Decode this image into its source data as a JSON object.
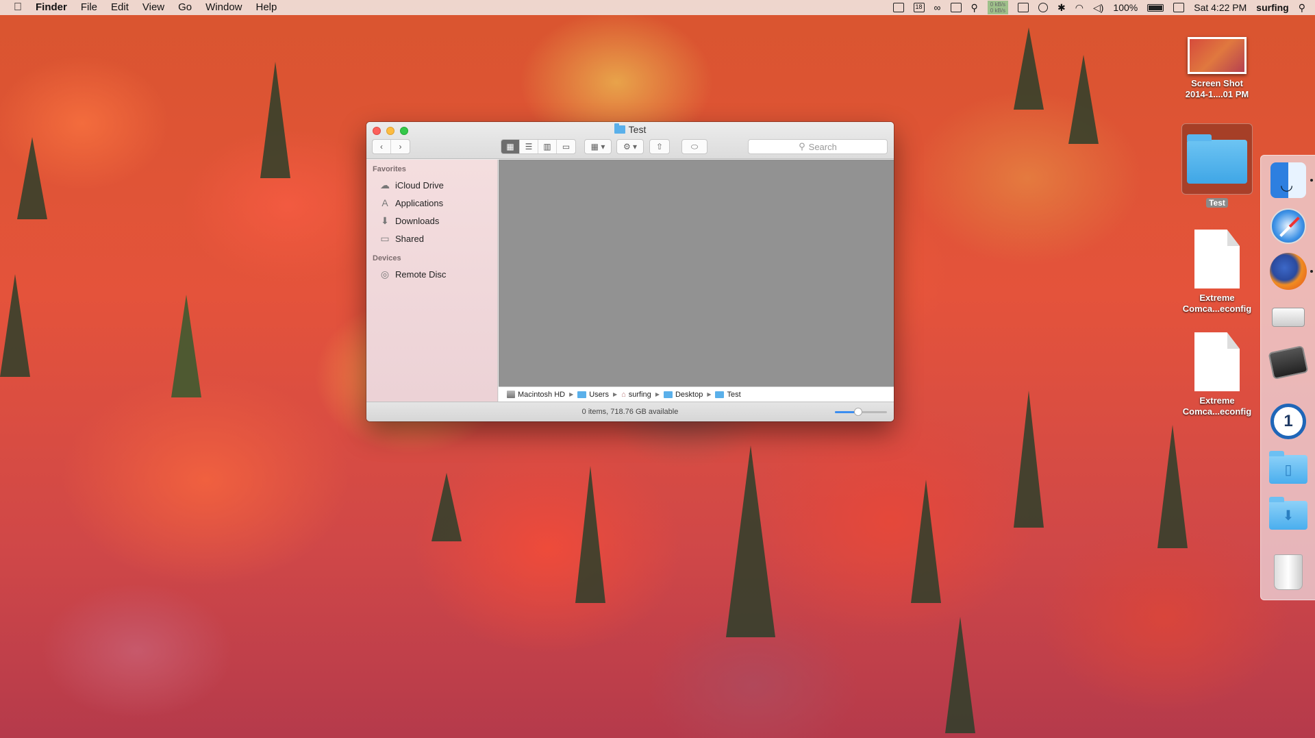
{
  "menubar": {
    "app_name": "Finder",
    "menus": [
      "File",
      "Edit",
      "View",
      "Go",
      "Window",
      "Help"
    ],
    "calendar_day": "18",
    "netspeed_up": "0 kB/s",
    "netspeed_down": "0 kB/s",
    "battery_percent": "100%",
    "clock": "Sat 4:22 PM",
    "username": "surfing",
    "icons": [
      "apple-icon",
      "dropbox-icon",
      "calendar-icon",
      "glasses-icon",
      "menu-extra-icon",
      "broom-icon",
      "airplay-icon",
      "time-machine-icon",
      "bluetooth-icon",
      "wifi-icon",
      "volume-icon",
      "battery-icon",
      "user-menu-icon",
      "spotlight-icon"
    ]
  },
  "window": {
    "title": "Test",
    "toolbar": {
      "search_placeholder": "Search",
      "view_modes": [
        "icon-view",
        "list-view",
        "column-view",
        "cover-flow-view"
      ],
      "active_view": "icon-view"
    },
    "sidebar": {
      "sections": [
        {
          "header": "Favorites",
          "items": [
            {
              "label": "iCloud Drive",
              "icon": "cloud-icon"
            },
            {
              "label": "Applications",
              "icon": "applications-icon"
            },
            {
              "label": "Downloads",
              "icon": "downloads-icon"
            },
            {
              "label": "Shared",
              "icon": "folder-icon"
            }
          ]
        },
        {
          "header": "Devices",
          "items": [
            {
              "label": "Remote Disc",
              "icon": "disc-icon"
            }
          ]
        }
      ]
    },
    "path": [
      "Macintosh HD",
      "Users",
      "surfing",
      "Desktop",
      "Test"
    ],
    "status_text": "0 items, 718.76 GB available",
    "icon_size_slider_fraction": 0.45
  },
  "desktop": {
    "items": [
      {
        "label_line1": "Screen Shot",
        "label_line2": "2014-1....01 PM",
        "kind": "screenshot"
      },
      {
        "label": "Test",
        "kind": "folder",
        "selected": true
      },
      {
        "label_line1": "Extreme",
        "label_line2": "Comca...econfig",
        "kind": "document"
      },
      {
        "label_line1": "Extreme",
        "label_line2": "Comca...econfig",
        "kind": "document"
      }
    ]
  },
  "dock": {
    "items": [
      "finder-icon",
      "safari-icon",
      "firefox-icon",
      "printer-icon",
      "photo-printer-icon",
      "1password-icon",
      "documents-folder-icon",
      "downloads-folder-icon",
      "trash-icon"
    ],
    "running": [
      "finder-icon",
      "firefox-icon"
    ]
  },
  "colors": {
    "accent_blue": "#3b8df0",
    "folder_blue": "#5ab0ea",
    "close_red": "#fc605b",
    "minimize_yellow": "#fdbc40",
    "zoom_green": "#34c84a"
  }
}
